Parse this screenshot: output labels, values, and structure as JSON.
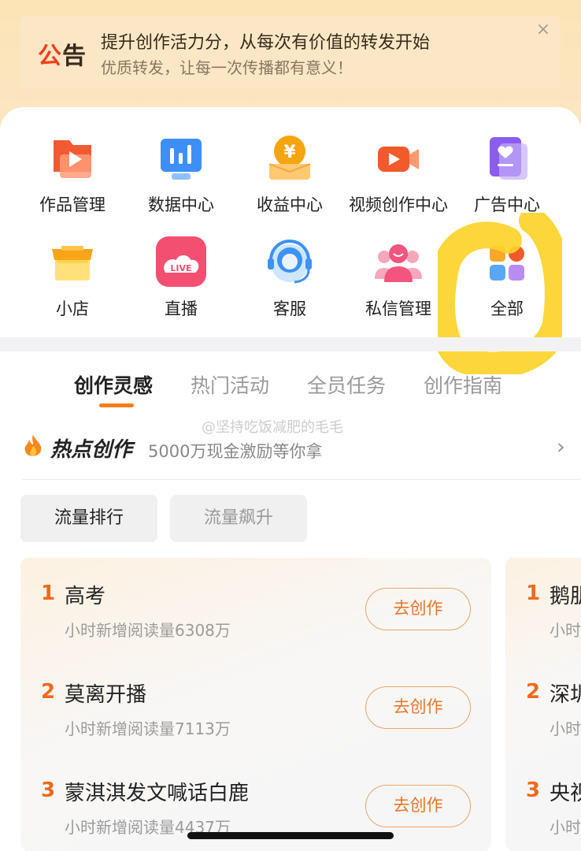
{
  "notice": {
    "badge_part1": "公",
    "badge_part2": "告",
    "title": "提升创作活力分，从每次有价值的转发开始",
    "subtitle": "优质转发，让每一次传播都有意义！",
    "close_glyph": "×"
  },
  "tools": [
    {
      "label": "作品管理",
      "icon": "works-icon"
    },
    {
      "label": "数据中心",
      "icon": "data-chart-icon"
    },
    {
      "label": "收益中心",
      "icon": "yuan-coin-icon"
    },
    {
      "label": "视频创作中心",
      "icon": "video-camera-icon"
    },
    {
      "label": "广告中心",
      "icon": "ad-heart-icon"
    },
    {
      "label": "小店",
      "icon": "shop-icon"
    },
    {
      "label": "直播",
      "icon": "live-icon"
    },
    {
      "label": "客服",
      "icon": "customer-service-icon"
    },
    {
      "label": "私信管理",
      "icon": "messages-icon"
    },
    {
      "label": "全部",
      "icon": "all-grid-icon"
    }
  ],
  "tabs": [
    "创作灵感",
    "热门活动",
    "全员任务",
    "创作指南"
  ],
  "watermark": "@坚持吃饭减肥的毛毛",
  "hot": {
    "title": "热点创作",
    "subtitle": "5000万现金激励等你拿",
    "arrow": "›"
  },
  "chips": [
    "流量排行",
    "流量飙升"
  ],
  "ranking_main": [
    {
      "num": "1",
      "name": "高考",
      "meta": "小时新增阅读量6308万",
      "button": "去创作"
    },
    {
      "num": "2",
      "name": "莫离开播",
      "meta": "小时新增阅读量7113万",
      "button": "去创作"
    },
    {
      "num": "3",
      "name": "蒙淇淇发文喊话白鹿",
      "meta": "小时新增阅读量4437万",
      "button": "去创作"
    }
  ],
  "ranking_next": [
    {
      "num": "1",
      "name": "鹅肌",
      "meta": "小时"
    },
    {
      "num": "2",
      "name": "深圳",
      "meta": "小时"
    },
    {
      "num": "3",
      "name": "央视",
      "meta": "小时"
    }
  ],
  "colors": {
    "accent_orange": "#f37f1a",
    "highlight_yellow": "#fcd42a",
    "notice_red": "#f0401d"
  }
}
